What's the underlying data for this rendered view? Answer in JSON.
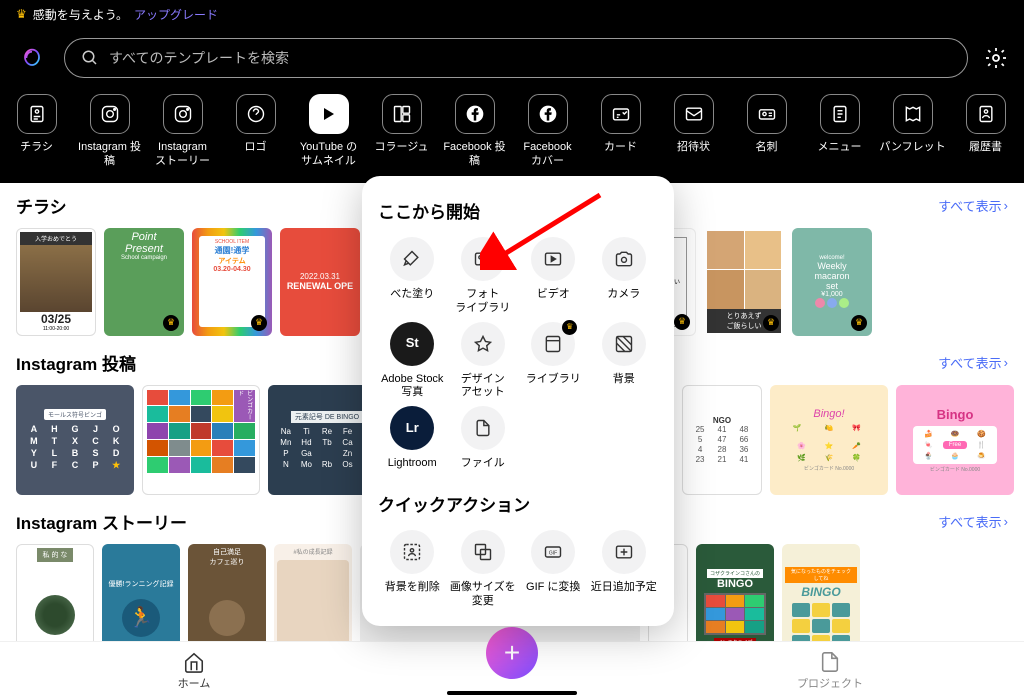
{
  "banner": {
    "text": "感動を与えよう。",
    "link": "アップグレード"
  },
  "search": {
    "placeholder": "すべてのテンプレートを検索"
  },
  "categories": [
    {
      "label": "チラシ",
      "icon": "flyer"
    },
    {
      "label": "Instagram 投稿",
      "icon": "ig"
    },
    {
      "label": "Instagram\nストーリー",
      "icon": "ig"
    },
    {
      "label": "ロゴ",
      "icon": "logo"
    },
    {
      "label": "YouTube の\nサムネイル",
      "icon": "yt"
    },
    {
      "label": "コラージュ",
      "icon": "collage"
    },
    {
      "label": "Facebook 投稿",
      "icon": "fb"
    },
    {
      "label": "Facebook\nカバー",
      "icon": "fb"
    },
    {
      "label": "カード",
      "icon": "card"
    },
    {
      "label": "招待状",
      "icon": "invite"
    },
    {
      "label": "名刺",
      "icon": "biz"
    },
    {
      "label": "メニュー",
      "icon": "menu"
    },
    {
      "label": "パンフレット",
      "icon": "broch"
    },
    {
      "label": "履歴書",
      "icon": "resume"
    }
  ],
  "viewAll": "すべて表示",
  "sections": {
    "flyer": {
      "title": "チラシ"
    },
    "ig": {
      "title": "Instagram 投稿"
    },
    "story": {
      "title": "Instagram ストーリー"
    }
  },
  "modal": {
    "title1": "ここから開始",
    "start": [
      {
        "label": "べた塗り",
        "icon": "fill"
      },
      {
        "label": "フォト\nライブラリ",
        "icon": "photo"
      },
      {
        "label": "ビデオ",
        "icon": "video"
      },
      {
        "label": "カメラ",
        "icon": "camera"
      },
      {
        "label": "Adobe Stock\n写真",
        "icon": "st"
      },
      {
        "label": "デザイン\nアセット",
        "icon": "asset"
      },
      {
        "label": "ライブラリ",
        "icon": "lib",
        "prem": true
      },
      {
        "label": "背景",
        "icon": "bg"
      },
      {
        "label": "Lightroom",
        "icon": "lr"
      },
      {
        "label": "ファイル",
        "icon": "file"
      }
    ],
    "title2": "クイックアクション",
    "quick": [
      {
        "label": "背景を削除",
        "icon": "removebg"
      },
      {
        "label": "画像サイズを\n変更",
        "icon": "resize"
      },
      {
        "label": "GIF に変換",
        "icon": "gif"
      },
      {
        "label": "近日追加予定",
        "icon": "soon"
      }
    ]
  },
  "bottomNav": {
    "home": "ホーム",
    "project": "プロジェクト"
  }
}
